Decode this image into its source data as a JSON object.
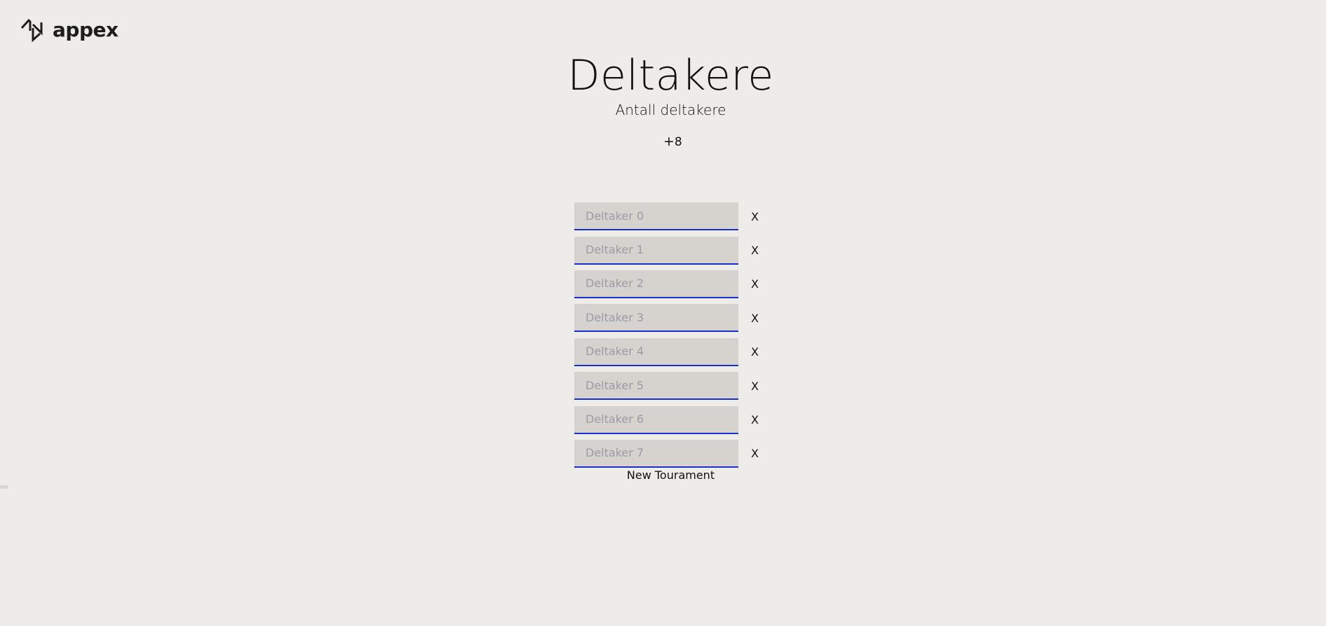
{
  "brand": {
    "name": "appex",
    "logo_icon": "appex-logo-icon"
  },
  "header": {
    "title": "Deltakere",
    "subtitle": "Antall deltakere"
  },
  "counter": {
    "plus": "+",
    "value": "8"
  },
  "participants": [
    {
      "placeholder": "Deltaker 0",
      "value": "",
      "remove_label": "X"
    },
    {
      "placeholder": "Deltaker 1",
      "value": "",
      "remove_label": "X"
    },
    {
      "placeholder": "Deltaker 2",
      "value": "",
      "remove_label": "X"
    },
    {
      "placeholder": "Deltaker 3",
      "value": "",
      "remove_label": "X"
    },
    {
      "placeholder": "Deltaker 4",
      "value": "",
      "remove_label": "X"
    },
    {
      "placeholder": "Deltaker 5",
      "value": "",
      "remove_label": "X"
    },
    {
      "placeholder": "Deltaker 6",
      "value": "",
      "remove_label": "X"
    },
    {
      "placeholder": "Deltaker 7",
      "value": "",
      "remove_label": "X"
    }
  ],
  "actions": {
    "new_tournament_label": "New Tourament"
  },
  "colors": {
    "background": "#edece8",
    "input_bg": "#d6d3ce",
    "input_underline": "#1a2fd0",
    "placeholder": "#9c9aa6"
  }
}
